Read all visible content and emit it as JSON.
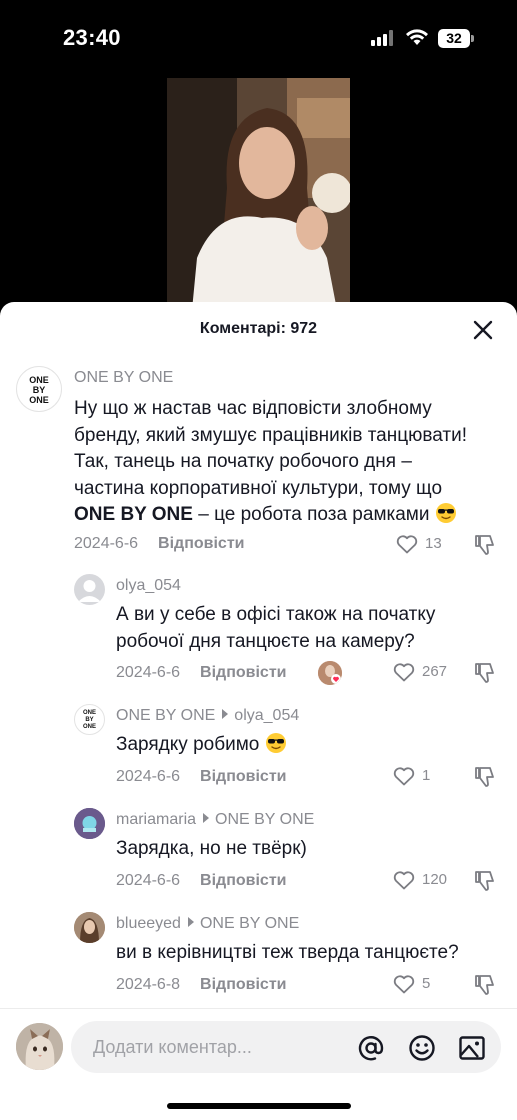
{
  "status_bar": {
    "time": "23:40",
    "battery": "32"
  },
  "sheet": {
    "title": "Коментарі: 972"
  },
  "comments": [
    {
      "user": "ONE BY ONE",
      "avatar_text": [
        "ONE",
        "BY",
        "ONE"
      ],
      "text_lines": [
        "Ну що ж настав час відповісти злобному",
        "бренду, який змушує працівників танцювати!",
        "Так, танець на початку робочого дня –",
        "частина корпоративної культури, тому що"
      ],
      "text_bold": "ONE BY ONE",
      "text_tail": " – це робота поза рамками",
      "date": "2024-6-6",
      "reply_label": "Відповісти",
      "likes": "13"
    },
    {
      "user": "olya_054",
      "text_lines": [
        "А ви у себе в офісі також на початку",
        "робочої дня танцюєте на камеру?"
      ],
      "date": "2024-6-6",
      "reply_label": "Відповісти",
      "likes": "267"
    },
    {
      "user": "ONE BY ONE",
      "reply_to": "olya_054",
      "avatar_text": [
        "ONE",
        "BY",
        "ONE"
      ],
      "text": "Зарядку робимо",
      "date": "2024-6-6",
      "reply_label": "Відповісти",
      "likes": "1"
    },
    {
      "user": "mariamaria",
      "reply_to": "ONE BY ONE",
      "text": "Зарядка, но не твёрк)",
      "date": "2024-6-6",
      "reply_label": "Відповісти",
      "likes": "120"
    },
    {
      "user": "blueeyed",
      "reply_to": "ONE BY ONE",
      "text": "ви в керівництві теж тверда танцюєте?",
      "date": "2024-6-8",
      "reply_label": "Відповісти",
      "likes": "5"
    }
  ],
  "input": {
    "placeholder": "Додати коментар..."
  },
  "colors": {
    "muted": "#8a8b91",
    "text": "#161823",
    "like_badge": "#fe2c55"
  },
  "icons": [
    "signal-icon",
    "wifi-icon",
    "battery-icon",
    "close-icon",
    "heart-icon",
    "dislike-icon",
    "mention-icon",
    "emoji-icon",
    "image-icon"
  ]
}
